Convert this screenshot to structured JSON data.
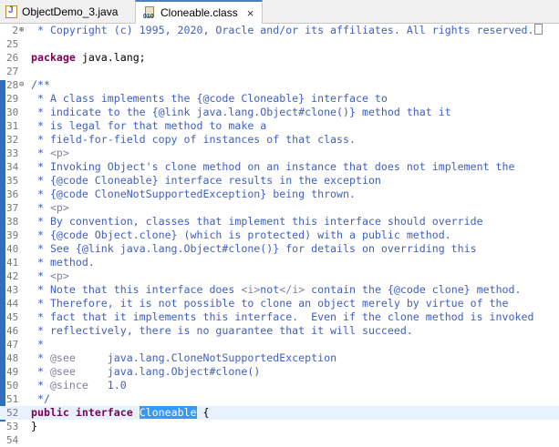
{
  "tabs": [
    {
      "title": "ObjectDemo_3.java",
      "icon": "java-file-icon",
      "active": false
    },
    {
      "title": "Cloneable.class",
      "icon": "class-file-icon",
      "active": true,
      "close": "×"
    }
  ],
  "icon_glyphs": {
    "java": "J",
    "class": "010"
  },
  "editor": {
    "lines": [
      {
        "n": "2",
        "fold": "⊕",
        "segs": [
          {
            "t": " * Copyright (c) 1995, 2020, Oracle and/or its affiliates. All rights reserved.",
            "c": "c"
          }
        ],
        "collapsed": true
      },
      {
        "n": "25",
        "segs": []
      },
      {
        "n": "26",
        "segs": [
          {
            "t": "package",
            "c": "k"
          },
          {
            "t": " java.lang;",
            "c": "plain"
          }
        ]
      },
      {
        "n": "27",
        "segs": []
      },
      {
        "n": "28",
        "fold": "⊖",
        "segs": [
          {
            "t": "/**",
            "c": "c"
          }
        ]
      },
      {
        "n": "29",
        "segs": [
          {
            "t": " * A class implements the {@code Cloneable} interface to",
            "c": "c"
          }
        ]
      },
      {
        "n": "30",
        "segs": [
          {
            "t": " * indicate to the {@link java.lang.Object#clone()} method that it",
            "c": "c"
          }
        ]
      },
      {
        "n": "31",
        "segs": [
          {
            "t": " * is legal for that method to make a",
            "c": "c"
          }
        ]
      },
      {
        "n": "32",
        "segs": [
          {
            "t": " * field-for-field copy of instances of that class.",
            "c": "c"
          }
        ]
      },
      {
        "n": "33",
        "segs": [
          {
            "t": " * ",
            "c": "c"
          },
          {
            "t": "<p>",
            "c": "t"
          }
        ]
      },
      {
        "n": "34",
        "segs": [
          {
            "t": " * Invoking Object's clone method on an instance that does not implement the",
            "c": "c"
          }
        ]
      },
      {
        "n": "35",
        "segs": [
          {
            "t": " * {@code Cloneable} interface results in the exception",
            "c": "c"
          }
        ]
      },
      {
        "n": "36",
        "segs": [
          {
            "t": " * {@code CloneNotSupportedException} being thrown.",
            "c": "c"
          }
        ]
      },
      {
        "n": "37",
        "segs": [
          {
            "t": " * ",
            "c": "c"
          },
          {
            "t": "<p>",
            "c": "t"
          }
        ]
      },
      {
        "n": "38",
        "segs": [
          {
            "t": " * By convention, classes that implement this interface should override",
            "c": "c"
          }
        ]
      },
      {
        "n": "39",
        "segs": [
          {
            "t": " * {@code Object.clone} (which is protected) with a public method.",
            "c": "c"
          }
        ]
      },
      {
        "n": "40",
        "segs": [
          {
            "t": " * See {@link java.lang.Object#clone()} for details on overriding this",
            "c": "c"
          }
        ]
      },
      {
        "n": "41",
        "segs": [
          {
            "t": " * method.",
            "c": "c"
          }
        ]
      },
      {
        "n": "42",
        "segs": [
          {
            "t": " * ",
            "c": "c"
          },
          {
            "t": "<p>",
            "c": "t"
          }
        ]
      },
      {
        "n": "43",
        "segs": [
          {
            "t": " * Note that this interface does ",
            "c": "c"
          },
          {
            "t": "<i>",
            "c": "t"
          },
          {
            "t": "not",
            "c": "c"
          },
          {
            "t": "</i>",
            "c": "t"
          },
          {
            "t": " contain the {@code clone} method.",
            "c": "c"
          }
        ]
      },
      {
        "n": "44",
        "segs": [
          {
            "t": " * Therefore, it is not possible to clone an object merely by virtue of the",
            "c": "c"
          }
        ]
      },
      {
        "n": "45",
        "segs": [
          {
            "t": " * fact that it implements this interface.  Even if the clone method is invoked",
            "c": "c"
          }
        ]
      },
      {
        "n": "46",
        "segs": [
          {
            "t": " * reflectively, there is no guarantee that it will succeed.",
            "c": "c"
          }
        ]
      },
      {
        "n": "47",
        "segs": [
          {
            "t": " *",
            "c": "c"
          }
        ]
      },
      {
        "n": "48",
        "segs": [
          {
            "t": " * ",
            "c": "c"
          },
          {
            "t": "@see",
            "c": "t"
          },
          {
            "t": "     java.lang.CloneNotSupportedException",
            "c": "c"
          }
        ]
      },
      {
        "n": "49",
        "segs": [
          {
            "t": " * ",
            "c": "c"
          },
          {
            "t": "@see",
            "c": "t"
          },
          {
            "t": "     java.lang.Object#clone()",
            "c": "c"
          }
        ]
      },
      {
        "n": "50",
        "segs": [
          {
            "t": " * ",
            "c": "c"
          },
          {
            "t": "@since",
            "c": "t"
          },
          {
            "t": "   1.0",
            "c": "c"
          }
        ]
      },
      {
        "n": "51",
        "segs": [
          {
            "t": " */",
            "c": "c"
          }
        ]
      },
      {
        "n": "52",
        "current": true,
        "segs": [
          {
            "t": "public",
            "c": "k"
          },
          {
            "t": " ",
            "c": "plain"
          },
          {
            "t": "interface",
            "c": "k"
          },
          {
            "t": " ",
            "c": "plain"
          },
          {
            "t": "Cloneable",
            "c": "sel"
          },
          {
            "t": " {",
            "c": "plain"
          }
        ]
      },
      {
        "n": "53",
        "segs": [
          {
            "t": "}",
            "c": "plain"
          }
        ]
      },
      {
        "n": "54",
        "segs": []
      }
    ]
  },
  "colors": {
    "keyword": "#7f0055",
    "javadoc": "#3f5fbf",
    "tag": "#7f7f9f",
    "selection": "#3399ff",
    "current_line": "#e8f2fe",
    "ruler": "#2f6fc1"
  }
}
